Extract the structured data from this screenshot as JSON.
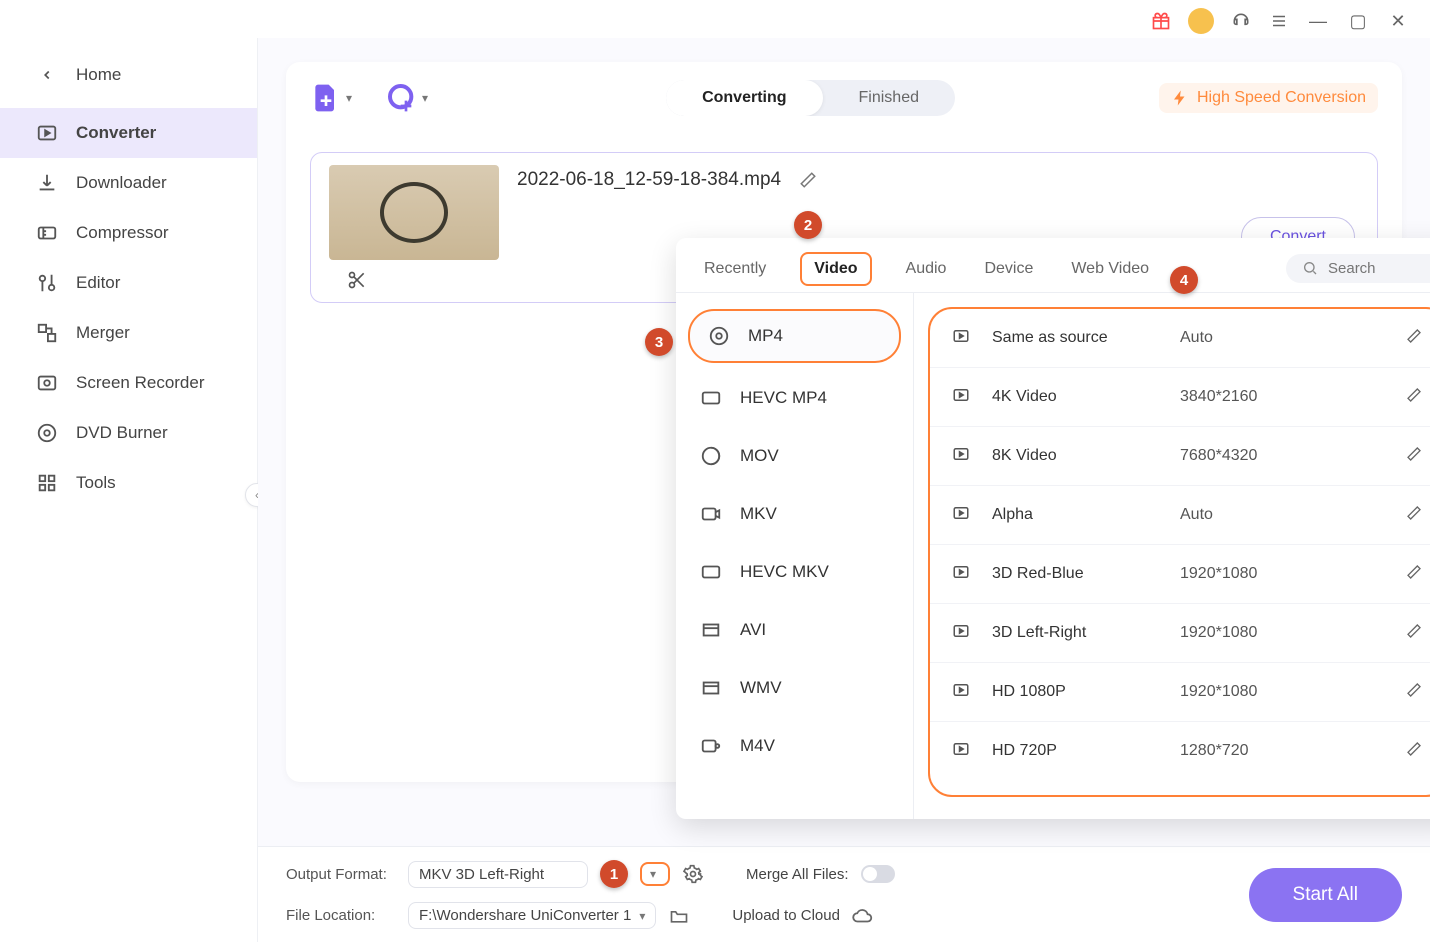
{
  "titlebar": {},
  "sidebar": {
    "home": "Home",
    "items": [
      {
        "label": "Converter"
      },
      {
        "label": "Downloader"
      },
      {
        "label": "Compressor"
      },
      {
        "label": "Editor"
      },
      {
        "label": "Merger"
      },
      {
        "label": "Screen Recorder"
      },
      {
        "label": "DVD Burner"
      },
      {
        "label": "Tools"
      }
    ]
  },
  "tabs": {
    "converting": "Converting",
    "finished": "Finished"
  },
  "hispeed": "High Speed Conversion",
  "file": {
    "name": "2022-06-18_12-59-18-384.mp4",
    "convert": "Convert"
  },
  "popup": {
    "tabs": {
      "recently": "Recently",
      "video": "Video",
      "audio": "Audio",
      "device": "Device",
      "webvideo": "Web Video"
    },
    "search_placeholder": "Search",
    "formats": [
      "MP4",
      "HEVC MP4",
      "MOV",
      "MKV",
      "HEVC MKV",
      "AVI",
      "WMV",
      "M4V"
    ],
    "resolutions": [
      {
        "name": "Same as source",
        "res": "Auto"
      },
      {
        "name": "4K Video",
        "res": "3840*2160"
      },
      {
        "name": "8K Video",
        "res": "7680*4320"
      },
      {
        "name": "Alpha",
        "res": "Auto"
      },
      {
        "name": "3D Red-Blue",
        "res": "1920*1080"
      },
      {
        "name": "3D Left-Right",
        "res": "1920*1080"
      },
      {
        "name": "HD 1080P",
        "res": "1920*1080"
      },
      {
        "name": "HD 720P",
        "res": "1280*720"
      }
    ]
  },
  "bottom": {
    "output_label": "Output Format:",
    "output_value": "MKV 3D Left-Right",
    "file_location_label": "File Location:",
    "file_location_value": "F:\\Wondershare UniConverter 1",
    "merge_label": "Merge All Files:",
    "upload_label": "Upload to Cloud",
    "start_all": "Start All"
  },
  "badges": [
    "1",
    "2",
    "3",
    "4"
  ]
}
